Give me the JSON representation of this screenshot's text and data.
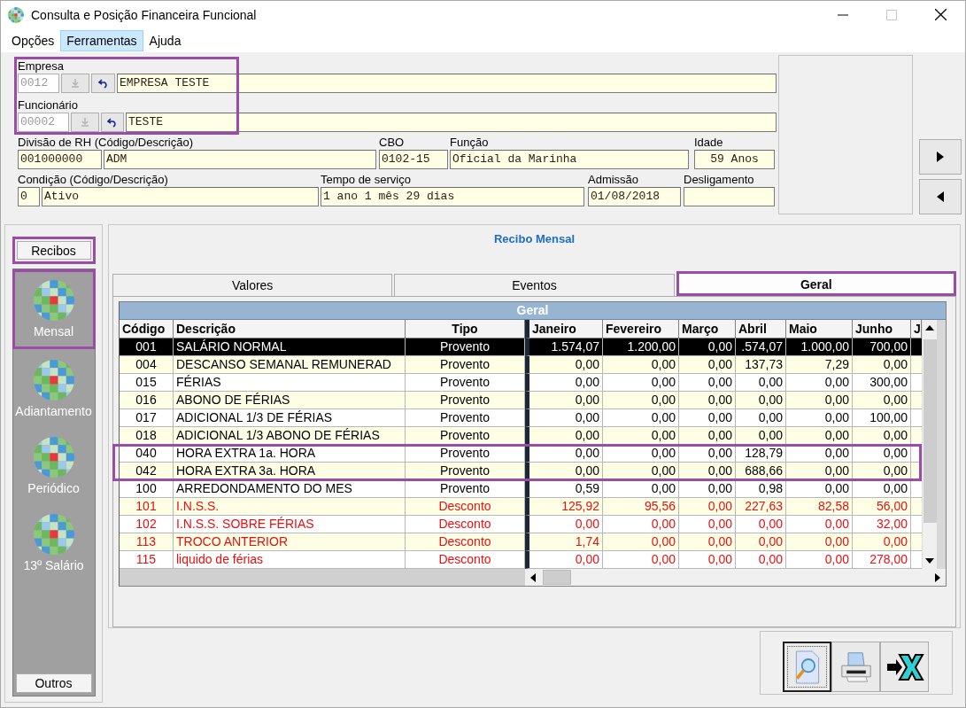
{
  "window": {
    "title": "Consulta e Posição Financeira Funcional"
  },
  "menu": [
    {
      "label": "Opções",
      "selected": false
    },
    {
      "label": "Ferramentas",
      "selected": true
    },
    {
      "label": "Ajuda",
      "selected": false
    }
  ],
  "lookups_highlighted": true,
  "empresa": {
    "label": "Empresa",
    "code": "0012",
    "name": "EMPRESA TESTE"
  },
  "funcionario": {
    "label": "Funcionário",
    "code": "00002",
    "name": "TESTE"
  },
  "divisao": {
    "label": "Divisão de RH (Código/Descrição)",
    "code": "001000000",
    "name": "ADM"
  },
  "cbo": {
    "label": "CBO",
    "value": "0102-15"
  },
  "funcao": {
    "label": "Função",
    "value": "Oficial da Marinha"
  },
  "idade": {
    "label": "Idade",
    "value": "59 Anos"
  },
  "condicao": {
    "label": "Condição (Código/Descrição)",
    "code": "0",
    "name": "Ativo"
  },
  "tempo": {
    "label": "Tempo de serviço",
    "value": "1 ano 1 mês 29 dias"
  },
  "admissao": {
    "label": "Admissão",
    "value": "01/08/2018"
  },
  "desligamento": {
    "label": "Desligamento"
  },
  "sidebar": {
    "header": {
      "label": "Recibos",
      "highlighted": true
    },
    "items": [
      {
        "label": "Mensal",
        "highlighted": true
      },
      {
        "label": "Adiantamento",
        "highlighted": false
      },
      {
        "label": "Periódico",
        "highlighted": false
      },
      {
        "label": "13º Salário",
        "highlighted": false
      }
    ],
    "footer": "Outros"
  },
  "panel_title": "Recibo Mensal",
  "tabs": [
    {
      "label": "Valores",
      "selected": false,
      "highlighted": false
    },
    {
      "label": "Eventos",
      "selected": false,
      "highlighted": false
    },
    {
      "label": "Geral",
      "selected": true,
      "highlighted": true
    }
  ],
  "grid": {
    "title": "Geral",
    "columns": [
      "Código",
      "Descrição",
      "Tipo",
      "Janeiro",
      "Fevereiro",
      "Março",
      "Abril",
      "Maio",
      "Junho",
      "J"
    ],
    "rows": [
      {
        "code": "001",
        "description": "SALÁRIO NORMAL",
        "type": "Provento",
        "kind": "provento",
        "selected": true,
        "highlighted": false,
        "values": [
          "1.574,07",
          "1.200,00",
          "0,00",
          ".574,07",
          "1.000,00",
          "700,00"
        ]
      },
      {
        "code": "004",
        "description": "DESCANSO SEMANAL REMUNERAD",
        "type": "Provento",
        "kind": "provento",
        "selected": false,
        "highlighted": false,
        "values": [
          "0,00",
          "0,00",
          "0,00",
          "137,73",
          "7,29",
          "0,00"
        ]
      },
      {
        "code": "015",
        "description": "FÉRIAS",
        "type": "Provento",
        "kind": "provento",
        "selected": false,
        "highlighted": false,
        "values": [
          "0,00",
          "0,00",
          "0,00",
          "0,00",
          "0,00",
          "300,00"
        ]
      },
      {
        "code": "016",
        "description": "ABONO DE FÉRIAS",
        "type": "Provento",
        "kind": "provento",
        "selected": false,
        "highlighted": false,
        "values": [
          "0,00",
          "0,00",
          "0,00",
          "0,00",
          "0,00",
          "0,00"
        ]
      },
      {
        "code": "017",
        "description": "ADICIONAL 1/3 DE FÉRIAS",
        "type": "Provento",
        "kind": "provento",
        "selected": false,
        "highlighted": false,
        "values": [
          "0,00",
          "0,00",
          "0,00",
          "0,00",
          "0,00",
          "100,00"
        ]
      },
      {
        "code": "018",
        "description": "ADICIONAL 1/3 ABONO DE FÉRIAS",
        "type": "Provento",
        "kind": "provento",
        "selected": false,
        "highlighted": false,
        "values": [
          "0,00",
          "0,00",
          "0,00",
          "0,00",
          "0,00",
          "0,00"
        ]
      },
      {
        "code": "040",
        "description": "HORA EXTRA 1a. HORA",
        "type": "Provento",
        "kind": "provento",
        "selected": false,
        "highlighted": true,
        "values": [
          "0,00",
          "0,00",
          "0,00",
          "128,79",
          "0,00",
          "0,00"
        ]
      },
      {
        "code": "042",
        "description": "HORA EXTRA 3a. HORA",
        "type": "Provento",
        "kind": "provento",
        "selected": false,
        "highlighted": true,
        "values": [
          "0,00",
          "0,00",
          "0,00",
          "688,66",
          "0,00",
          "0,00"
        ]
      },
      {
        "code": "100",
        "description": "ARREDONDAMENTO DO MES",
        "type": "Provento",
        "kind": "provento",
        "selected": false,
        "highlighted": false,
        "values": [
          "0,59",
          "0,00",
          "0,00",
          "0,98",
          "0,00",
          "0,00"
        ]
      },
      {
        "code": "101",
        "description": "I.N.S.S.",
        "type": "Desconto",
        "kind": "desconto",
        "selected": false,
        "highlighted": false,
        "values": [
          "125,92",
          "95,56",
          "0,00",
          "227,63",
          "82,58",
          "56,00"
        ]
      },
      {
        "code": "102",
        "description": "I.N.S.S. SOBRE FÉRIAS",
        "type": "Desconto",
        "kind": "desconto",
        "selected": false,
        "highlighted": false,
        "values": [
          "0,00",
          "0,00",
          "0,00",
          "0,00",
          "0,00",
          "32,00"
        ]
      },
      {
        "code": "113",
        "description": "TROCO ANTERIOR",
        "type": "Desconto",
        "kind": "desconto",
        "selected": false,
        "highlighted": false,
        "values": [
          "1,74",
          "0,00",
          "0,00",
          "0,00",
          "0,00",
          "0,00"
        ]
      },
      {
        "code": "115",
        "description": "liquido de férias",
        "type": "Desconto",
        "kind": "desconto",
        "selected": false,
        "highlighted": false,
        "values": [
          "0,00",
          "0,00",
          "0,00",
          "0,00",
          "0,00",
          "278,00"
        ]
      }
    ]
  },
  "toolbar": [
    {
      "kind": "preview",
      "selected": true
    },
    {
      "kind": "print",
      "selected": false
    },
    {
      "kind": "export",
      "selected": false
    }
  ]
}
